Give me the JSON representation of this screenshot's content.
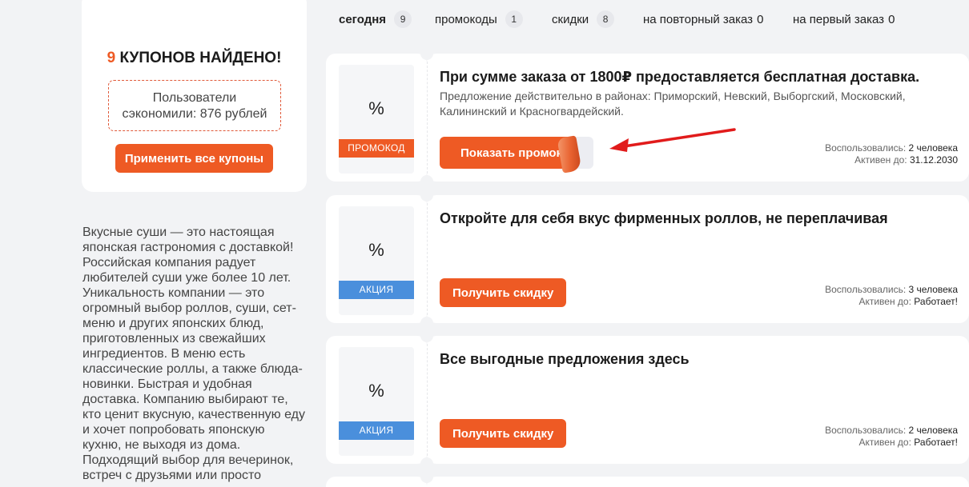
{
  "summary": {
    "found_count": "9",
    "found_text": "КУПОНОВ НАЙДЕНО!",
    "saved_line1": "Пользователи",
    "saved_line2": "сэкономили: 876 рублей",
    "apply_all_label": "Применить все купоны"
  },
  "about_text": "Вкусные суши — это настоящая японская гастрономия с доставкой! Российская компания радует любителей суши уже более 10 лет. Уникальность компании — это огромный выбор роллов, суши, сет-меню и других японских блюд, приготовленных из свежайших ингредиентов. В меню есть классические роллы, а также блюда-новинки. Быстрая и удобная доставка. Компанию выбирают те, кто ценит вкусную, качественную еду и хочет попробовать японскую кухню, не выходя из дома. Подходящий выбор для вечеринок, встреч с друзьями или просто",
  "tabs": [
    {
      "label": "сегодня",
      "count": "9"
    },
    {
      "label": "промокоды",
      "count": "1"
    },
    {
      "label": "скидки",
      "count": "8"
    },
    {
      "label": "на повторный заказ",
      "count": "0"
    },
    {
      "label": "на первый заказ",
      "count": "0"
    }
  ],
  "coupons": [
    {
      "percent_symbol": "%",
      "type_label": "ПРОМОКОД",
      "title": "При сумме заказа от 1800₽ предоставляется бесплатная доставка.",
      "description": "Предложение действительно в районах: Приморский, Невский, Выборгский, Московский, Калининский и Красногвардейский.",
      "button_label": "Показать промокод",
      "used_label": "Воспользовались:",
      "used_value": "2 человека",
      "active_label": "Активен до:",
      "active_value": "31.12.2030"
    },
    {
      "percent_symbol": "%",
      "type_label": "АКЦИЯ",
      "title": "Откройте для себя вкус фирменных роллов, не переплачивая",
      "button_label": "Получить скидку",
      "used_label": "Воспользовались:",
      "used_value": "3 человека",
      "active_label": "Активен до:",
      "active_value": "Работает!"
    },
    {
      "percent_symbol": "%",
      "type_label": "АКЦИЯ",
      "title": "Все выгодные предложения здесь",
      "button_label": "Получить скидку",
      "used_label": "Воспользовались:",
      "used_value": "2 человека",
      "active_label": "Активен до:",
      "active_value": "Работает!"
    }
  ],
  "colors": {
    "accent": "#ee5a24",
    "action_label": "#4a8fdc",
    "arrow": "#e11b1b",
    "page_bg": "#f2f3f5"
  }
}
